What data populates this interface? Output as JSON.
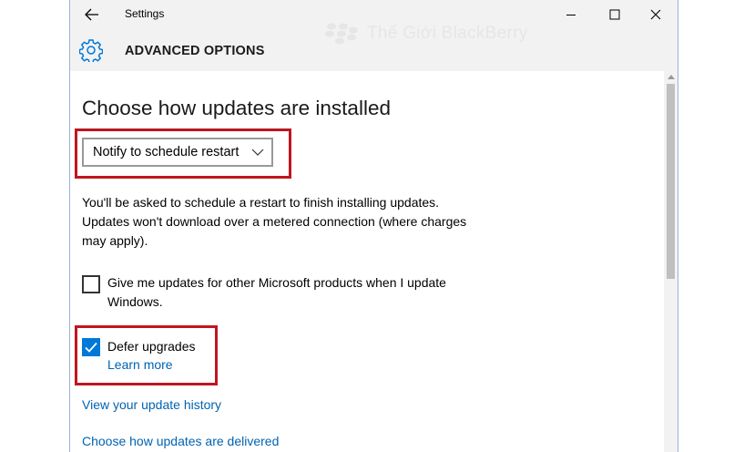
{
  "window": {
    "title": "Settings",
    "header_title": "ADVANCED OPTIONS",
    "watermark": "Thế Giới BlackBerry"
  },
  "main": {
    "heading": "Choose how updates are installed",
    "install_dropdown": {
      "selected": "Notify to schedule restart"
    },
    "description": "You'll be asked to schedule a restart to finish installing updates. Updates won't download over a metered connection (where charges may apply).",
    "option_ms_products": {
      "label": "Give me updates for other Microsoft products when I update Windows.",
      "checked": false
    },
    "option_defer": {
      "label": "Defer upgrades",
      "checked": true,
      "link": "Learn more"
    },
    "links": {
      "history": "View your update history",
      "delivery": "Choose how updates are delivered"
    }
  },
  "colors": {
    "accent": "#0078d7",
    "link": "#0063b1",
    "highlight_box": "#c0161f",
    "chrome": "#f2f2f2"
  },
  "icons": [
    "back-arrow-icon",
    "minimize-icon",
    "maximize-icon",
    "close-icon",
    "gear-icon",
    "checkmark-icon",
    "chevron-down-icon"
  ]
}
